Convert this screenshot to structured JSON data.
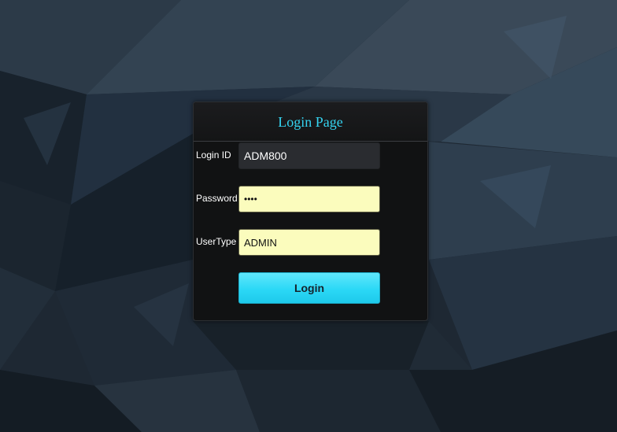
{
  "login": {
    "title": "Login Page",
    "login_id_label": "Login ID",
    "login_id_value": "ADM800",
    "password_label": "Password",
    "password_value": "••••",
    "usertype_label": "UserType",
    "usertype_value": "ADMIN",
    "login_button": "Login"
  },
  "colors": {
    "title": "#35d3f0",
    "button": "#2bd8f6",
    "autofill_field": "#fbfcbd",
    "panel": "#111213"
  }
}
